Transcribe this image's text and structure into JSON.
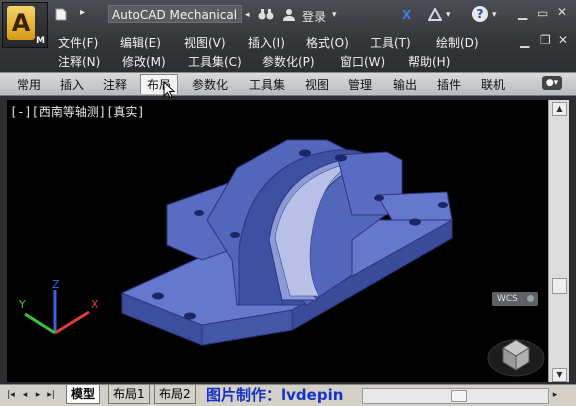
{
  "app": {
    "title": "AutoCAD Mechanical",
    "logo_letter": "A",
    "logo_badge": "M",
    "login_label": "登录",
    "help_symbol": "?",
    "search_arrows": "▸"
  },
  "menu_row1": [
    "文件(F)",
    "编辑(E)",
    "视图(V)",
    "插入(I)",
    "格式(O)",
    "工具(T)",
    "绘制(D)"
  ],
  "menu_row2": [
    "注释(N)",
    "修改(M)",
    "工具集(C)",
    "参数化(P)",
    "窗口(W)",
    "帮助(H)"
  ],
  "ribbon_tabs": [
    "常用",
    "插入",
    "注释",
    "布局",
    "参数化",
    "工具集",
    "视图",
    "管理",
    "输出",
    "插件",
    "联机"
  ],
  "ribbon_active": "布局",
  "viewport": {
    "label": "[-][西南等轴测][真实]",
    "wcs_label": "WCS",
    "axis_x": "X",
    "axis_y": "Y",
    "axis_z": "Z"
  },
  "bottom": {
    "tabs": [
      "模型",
      "布局1",
      "布局2"
    ],
    "active_tab": "模型",
    "credit": "图片制作：lvdepin"
  },
  "colors": {
    "model_blue": "#5b6fc4",
    "axis_x": "#e03b3b",
    "axis_y": "#3bc43b",
    "axis_z": "#3b63e0",
    "credit": "#1533c8"
  }
}
